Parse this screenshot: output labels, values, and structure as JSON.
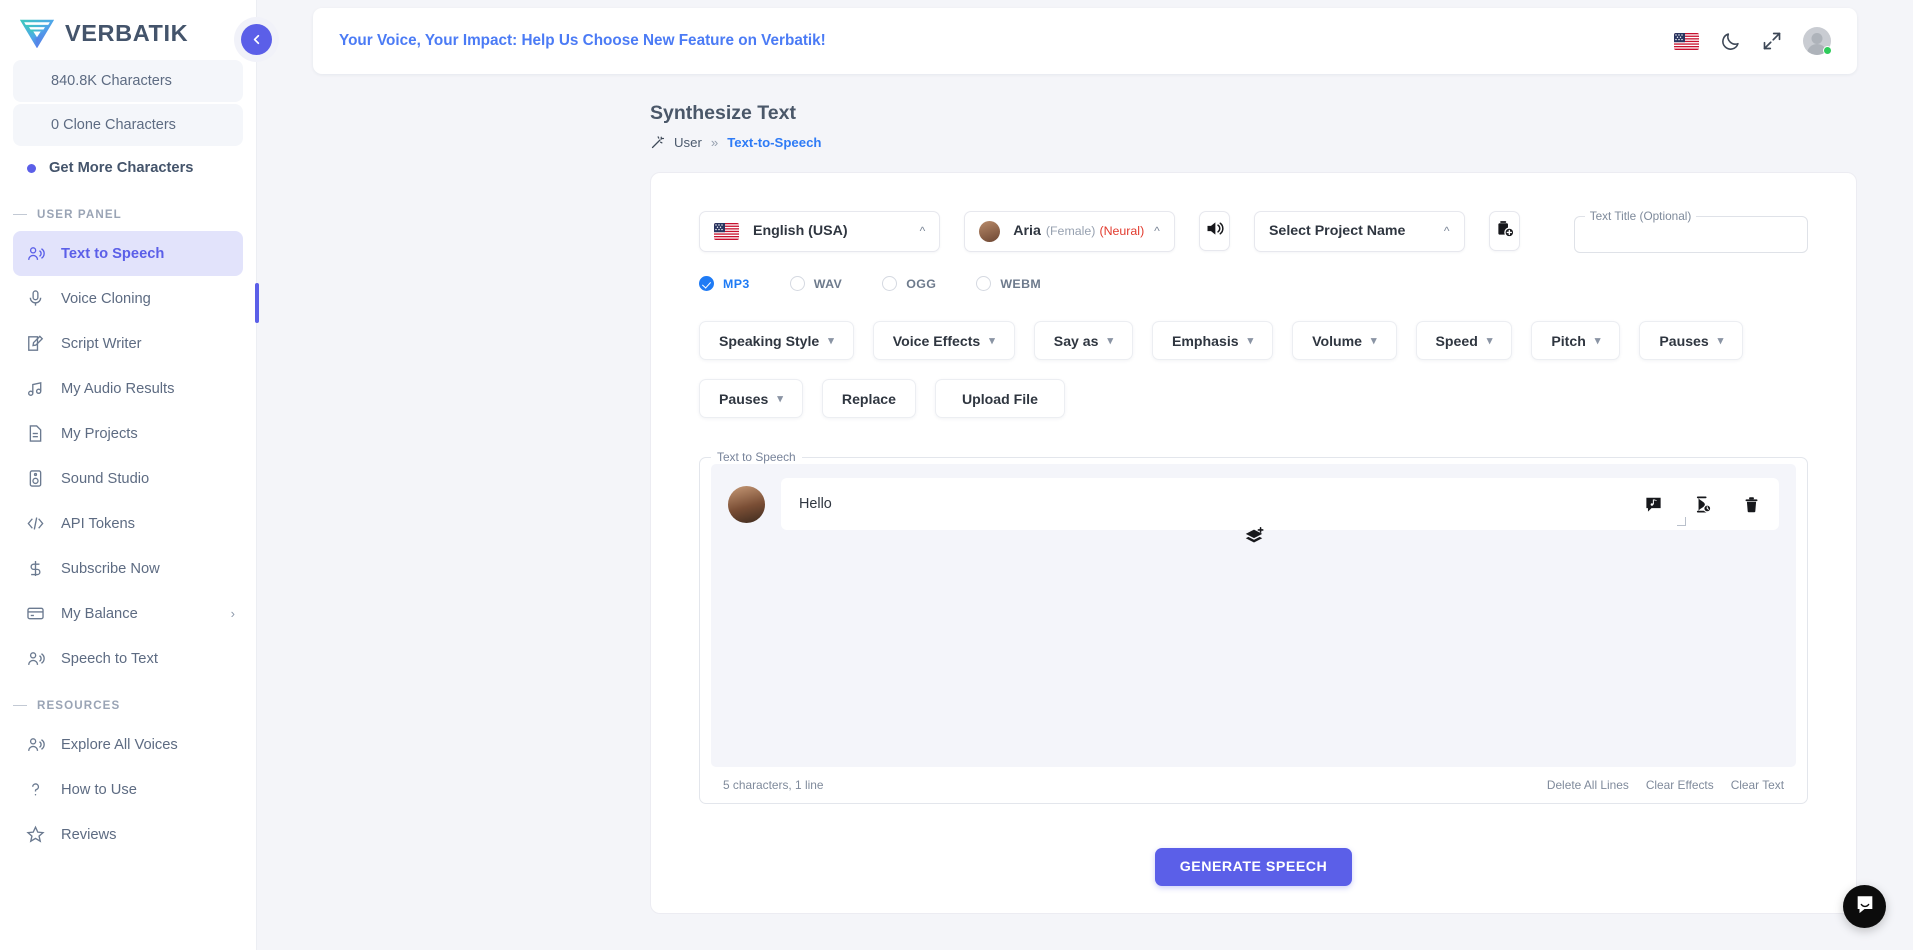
{
  "brand": {
    "name": "VERBATIK"
  },
  "sidebar": {
    "stats": [
      {
        "label": "840.8K Characters"
      },
      {
        "label": "0 Clone Characters"
      }
    ],
    "get_more": "Get More Characters",
    "sections": [
      {
        "title": "USER PANEL",
        "items": [
          {
            "label": "Text to Speech",
            "icon": "speech-person-icon",
            "active": true
          },
          {
            "label": "Voice Cloning",
            "icon": "microphone-icon"
          },
          {
            "label": "Script Writer",
            "icon": "pencil-square-icon"
          },
          {
            "label": "My Audio Results",
            "icon": "music-note-icon"
          },
          {
            "label": "My Projects",
            "icon": "document-icon"
          },
          {
            "label": "Sound Studio",
            "icon": "speaker-box-icon"
          },
          {
            "label": "API Tokens",
            "icon": "code-brackets-icon"
          },
          {
            "label": "Subscribe Now",
            "icon": "dollar-icon"
          },
          {
            "label": "My Balance",
            "icon": "credit-card-icon",
            "chevron": "›"
          },
          {
            "label": "Speech to Text",
            "icon": "speech-person-icon"
          }
        ]
      },
      {
        "title": "RESOURCES",
        "items": [
          {
            "label": "Explore All Voices",
            "icon": "speech-person-icon"
          },
          {
            "label": "How to Use",
            "icon": "question-mark-icon"
          },
          {
            "label": "Reviews",
            "icon": "star-icon"
          }
        ]
      }
    ]
  },
  "header": {
    "banner_text": "Your Voice, Your Impact: Help Us Choose New Feature on Verbatik!",
    "icons": [
      {
        "name": "flag-usa-icon"
      },
      {
        "name": "moon-dark-mode-icon"
      },
      {
        "name": "fullscreen-expand-icon"
      },
      {
        "name": "user-avatar"
      }
    ]
  },
  "page": {
    "title": "Synthesize Text",
    "breadcrumb": {
      "icon": "magic-wand-icon",
      "parent": "User",
      "separator": "»",
      "current": "Text-to-Speech"
    }
  },
  "controls": {
    "language": {
      "value": "English (USA)",
      "flag": "flag-usa-icon"
    },
    "voice": {
      "name": "Aria",
      "gender": "(Female)",
      "type": "(Neural)"
    },
    "preview_icon": "speaker-volume-icon",
    "project": {
      "value": "Select Project Name"
    },
    "add_project_icon": "add-project-icon",
    "text_title": {
      "label": "Text Title (Optional)",
      "value": "",
      "placeholder": ""
    },
    "formats": [
      {
        "label": "MP3",
        "selected": true
      },
      {
        "label": "WAV",
        "selected": false
      },
      {
        "label": "OGG",
        "selected": false
      },
      {
        "label": "WEBM",
        "selected": false
      }
    ],
    "buttons": [
      {
        "label": "Speaking Style",
        "chevron": true
      },
      {
        "label": "Voice Effects",
        "chevron": true
      },
      {
        "label": "Say as",
        "chevron": true
      },
      {
        "label": "Emphasis",
        "chevron": true
      },
      {
        "label": "Volume",
        "chevron": true
      },
      {
        "label": "Speed",
        "chevron": true
      },
      {
        "label": "Pitch",
        "chevron": true
      },
      {
        "label": "Pauses",
        "chevron": true
      },
      {
        "label": "Pauses",
        "chevron": true
      },
      {
        "label": "Replace",
        "chevron": false
      },
      {
        "label": "Upload File",
        "chevron": false
      }
    ]
  },
  "editor": {
    "legend": "Text to Speech",
    "line_text": "Hello",
    "line_icons": [
      {
        "name": "sound-effect-bubble-icon"
      },
      {
        "name": "pause-timer-icon"
      },
      {
        "name": "delete-trash-icon"
      }
    ],
    "add_line_icon": "add-layer-icon",
    "status": "5 characters, 1 line",
    "actions": [
      "Delete All Lines",
      "Clear Effects",
      "Clear Text"
    ]
  },
  "footer": {
    "generate_label": "GENERATE SPEECH"
  },
  "chat": {
    "icon": "chat-bubble-icon"
  },
  "colors": {
    "accent": "#5b5fe8",
    "link": "#4b7bf5",
    "radio_active": "#1f7bf5",
    "neural_red": "#e23b2e"
  }
}
